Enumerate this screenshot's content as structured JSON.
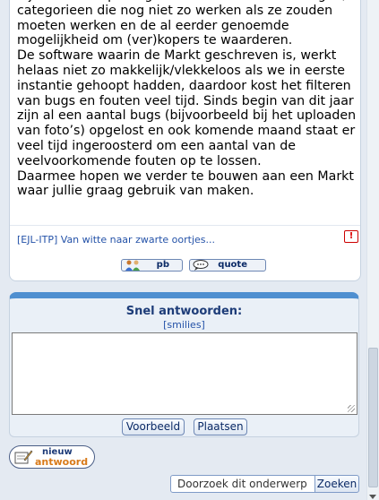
{
  "post": {
    "paragraph1": "bijvoorbeeld op het gebied van rare foutmeldingen, categorieen die nog niet zo werken als ze zouden moeten werken en de al eerder genoemde mogelijkheid om (ver)kopers te waarderen.",
    "paragraph2": "De software waarin de Markt geschreven is, werkt helaas niet zo makkelijk/vlekkeloos als we in eerste instantie gehoopt hadden, daardoor kost het filteren van bugs en fouten veel tijd. Sinds begin van dit jaar zijn al een aantal bugs (bijvoorbeeld bij het uploaden van foto’s) opgelost en ook komende maand staat er veel tijd ingeroosterd om een aantal van de veelvoorkomende fouten op te lossen.",
    "paragraph3": "Daarmee hopen we verder te bouwen aan een Markt waar jullie graag gebruik van maken.",
    "signature_link": "[EJL-ITP] Van witte naar zwarte oortjes...",
    "report_icon": "!",
    "pb_label": "pb",
    "quote_label": "quote"
  },
  "quick_reply": {
    "title": "Snel antwoorden:",
    "smilies": "[smilies]",
    "text": "",
    "preview_label": "Voorbeeld",
    "post_label": "Plaatsen"
  },
  "new_reply": {
    "line1": "nieuw",
    "line2": "antwoord"
  },
  "search": {
    "value": "Doorzoek dit onderwerp",
    "button": "Zoeken"
  },
  "colors": {
    "accent": "#4f8fd0",
    "title": "#1d3c78",
    "link": "#2452a8",
    "new_reply_orange": "#d87a1a"
  }
}
